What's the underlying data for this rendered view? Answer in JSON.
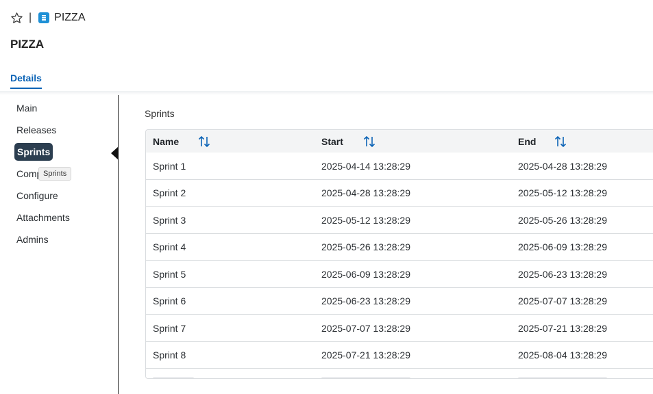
{
  "header": {
    "breadcrumb_separator": "|",
    "project_name": "PIZZA",
    "icons": {
      "favorite": "star-outline-icon",
      "project": "project-board-icon"
    }
  },
  "page": {
    "title": "PIZZA"
  },
  "tabs": [
    {
      "label": "Details",
      "active": true
    }
  ],
  "sidebar": {
    "items": [
      {
        "label": "Main"
      },
      {
        "label": "Releases"
      },
      {
        "label": "Sprints",
        "active": true
      },
      {
        "label": "Comp"
      },
      {
        "label": "Configure"
      },
      {
        "label": "Attachments"
      },
      {
        "label": "Admins"
      }
    ],
    "tooltip": "Sprints"
  },
  "main": {
    "section_label": "Sprints",
    "columns": [
      {
        "label": "Name",
        "sort_icon": "sort-arrows-icon"
      },
      {
        "label": "Start",
        "sort_icon": "sort-arrows-icon"
      },
      {
        "label": "End",
        "sort_icon": "sort-arrows-icon"
      }
    ],
    "rows": [
      {
        "name": "Sprint 1",
        "start": "2025-04-14 13:28:29",
        "end": "2025-04-28 13:28:29"
      },
      {
        "name": "Sprint 2",
        "start": "2025-04-28 13:28:29",
        "end": "2025-05-12 13:28:29"
      },
      {
        "name": "Sprint 3",
        "start": "2025-05-12 13:28:29",
        "end": "2025-05-26 13:28:29"
      },
      {
        "name": "Sprint 4",
        "start": "2025-05-26 13:28:29",
        "end": "2025-06-09 13:28:29"
      },
      {
        "name": "Sprint 5",
        "start": "2025-06-09 13:28:29",
        "end": "2025-06-23 13:28:29"
      },
      {
        "name": "Sprint 6",
        "start": "2025-06-23 13:28:29",
        "end": "2025-07-07 13:28:29"
      },
      {
        "name": "Sprint 7",
        "start": "2025-07-07 13:28:29",
        "end": "2025-07-21 13:28:29"
      },
      {
        "name": "Sprint 8",
        "start": "2025-07-21 13:28:29",
        "end": "2025-08-04 13:28:29"
      }
    ]
  },
  "colors": {
    "accent": "#0b63b6",
    "active_nav": "#2c3e50",
    "app_icon": "#1e90d6"
  }
}
